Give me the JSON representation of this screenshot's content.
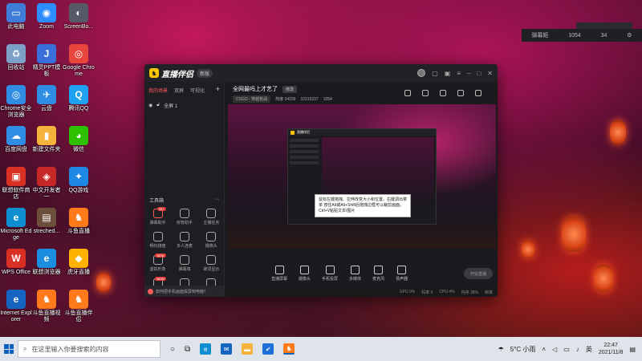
{
  "desktop": {
    "icons": [
      {
        "label": "此电脑",
        "glyph": "▭",
        "color": "#3d7dd8"
      },
      {
        "label": "Zoom",
        "glyph": "◉",
        "color": "#2d8cff"
      },
      {
        "label": "ScreenBo...",
        "glyph": "◐",
        "color": "#555a66"
      },
      {
        "label": "回收站",
        "glyph": "♻",
        "color": "#7ca0c8"
      },
      {
        "label": "精灵PPT模板",
        "glyph": "J",
        "color": "#3a6ed8"
      },
      {
        "label": "Google Chrome",
        "glyph": "◎",
        "color": "#e8453c"
      },
      {
        "label": "Chrome安全浏览器",
        "glyph": "◎",
        "color": "#2f8de4"
      },
      {
        "label": "云盘",
        "glyph": "✈",
        "color": "#2f8de4"
      },
      {
        "label": "腾讯QQ",
        "glyph": "Q",
        "color": "#1ea2f1"
      },
      {
        "label": "百度网盘",
        "glyph": "☁",
        "color": "#2f8de4"
      },
      {
        "label": "新建文件夹",
        "glyph": "▮",
        "color": "#f5b23d"
      },
      {
        "label": "微信",
        "glyph": "◕",
        "color": "#2dc100"
      },
      {
        "label": "联想软件商店",
        "glyph": "▣",
        "color": "#d93025"
      },
      {
        "label": "中文开发者一",
        "glyph": "◈",
        "color": "#c62828"
      },
      {
        "label": "QQ游戏",
        "glyph": "✦",
        "color": "#1e88e5"
      },
      {
        "label": "Microsoft Edge",
        "glyph": "e",
        "color": "#0f8fd1"
      },
      {
        "label": "streched...",
        "glyph": "▤",
        "color": "#6b4f3a"
      },
      {
        "label": "斗鱼直播",
        "glyph": "♞",
        "color": "#ff7a1a"
      },
      {
        "label": "WPS Office",
        "glyph": "W",
        "color": "#d93025"
      },
      {
        "label": "联想浏览器",
        "glyph": "e",
        "color": "#1b8ee0"
      },
      {
        "label": "虎牙直播",
        "glyph": "◆",
        "color": "#ffb300"
      },
      {
        "label": "Internet Explorer",
        "glyph": "e",
        "color": "#1565c0"
      },
      {
        "label": "斗鱼直播视频",
        "glyph": "♞",
        "color": "#ff7a1a"
      },
      {
        "label": "斗鱼直播伴侣",
        "glyph": "♞",
        "color": "#ff7a1a"
      }
    ]
  },
  "topright": {
    "items": [
      "弹幕姬",
      "1054",
      "34",
      "⚙"
    ]
  },
  "app": {
    "name": "直播伴侣",
    "version": "新版",
    "sidebar": {
      "tabs": [
        "我的场景",
        "双屏",
        "可视化"
      ],
      "add": "+",
      "scene_label": "全屏 1",
      "tools_title": "工具箱",
      "tools": [
        {
          "label": "弹幕助手",
          "badge": "99+"
        },
        {
          "label": "房管助手",
          "badge": ""
        },
        {
          "label": "主播任务",
          "badge": ""
        },
        {
          "label": "畅玩接盘",
          "badge": ""
        },
        {
          "label": "多人连麦",
          "badge": ""
        },
        {
          "label": "摄像头",
          "badge": ""
        },
        {
          "label": "虚拟形象",
          "badge": "NEW"
        },
        {
          "label": "弹幕墙",
          "badge": ""
        },
        {
          "label": "歌词显示",
          "badge": ""
        },
        {
          "label": "",
          "badge": "NEW"
        },
        {
          "label": "",
          "badge": ""
        },
        {
          "label": "",
          "badge": ""
        }
      ],
      "tip": "如何把手机画面投屏到电脑？"
    },
    "room": {
      "title": "全网最吗上才艺了",
      "modify": "修改",
      "category": "CSGO - 穿越枪战",
      "stats": [
        "热度 34239",
        "10315237",
        "1054"
      ]
    },
    "tooltip": "鼠标左键拖拽、拉伸改变大小和位置。右键调出菜单 按住Alt或Alt+Shift后拖拽边框可以裁剪画面。Ctrl+V粘贴文本/图片",
    "inner_app_name": "直播伴侣",
    "bottom_tools": [
      "直播屏幕",
      "摄像头",
      "手机投屏",
      "多媒体",
      "麦克风",
      "扬声器"
    ],
    "start_live": "开始直播",
    "status": [
      "GPU 0%",
      "码率 0",
      "CPU 4%",
      "内存 38%",
      "帧率"
    ]
  },
  "taskbar": {
    "search_placeholder": "在这里输入你要搜索的内容",
    "weather": "5°C 小雨",
    "lang": "英",
    "time": "22:47",
    "date": "2021/11/8"
  }
}
